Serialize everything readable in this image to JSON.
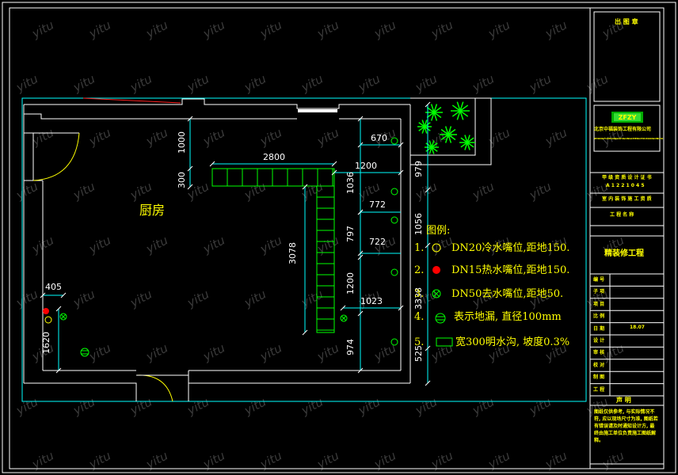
{
  "room_label": "厨房",
  "dimensions": {
    "top_width": "2800",
    "top_height": "1000",
    "counter_depth": "300",
    "counter_len": "3078",
    "d670": "670",
    "d1200a": "1200",
    "d1036": "1036",
    "d772": "772",
    "d797": "797",
    "d722": "722",
    "d1200b": "1200",
    "d1023": "1023",
    "d974": "974",
    "d979": "979",
    "d1056": "1056",
    "d3338": "3338",
    "d525": "525",
    "d405": "405",
    "d1620": "1620"
  },
  "legend": {
    "title": "图例:",
    "items": [
      {
        "num": "1.",
        "text": "DN20冷水嘴位,距地150."
      },
      {
        "num": "2.",
        "text": "DN15热水嘴位,距地150."
      },
      {
        "num": "3.",
        "text": "DN50去水嘴位,距地50."
      },
      {
        "num": "4.",
        "text": "表示地漏, 直径100mm"
      },
      {
        "num": "5.",
        "text": "宽300明水沟, 坡度0.3%"
      }
    ]
  },
  "title_block": {
    "stamp": "出 图 章",
    "company": "北京中福装饰工程有限公司",
    "company_sub": "ZHONGFUZHUANGSHIGONGCHENGYOUXIANGONGSI",
    "cert1": "甲 级 资 质 设 计 证 书",
    "cert2": "A 1 2 2 1 0 4 5",
    "cert3": "室 内 装 饰 施 工 资 质",
    "project_name_label": "工 程 名 称",
    "project_name": "精装修工程",
    "rows": [
      "编 号",
      "子 项",
      "项 目",
      "比 例",
      "日 期",
      "设 计",
      "审 核",
      "校 对",
      "制 图",
      "工 程"
    ],
    "date_val": "18.07",
    "statement_label": "声 明",
    "statement_text": "图纸仅供参考, 与实际情况不符, 应以现场尺寸为准, 图纸若有错误请及时通知设计方, 最终由施工单位负责施工图纸解释。"
  },
  "watermark": "yitu",
  "colors": {
    "background": "#000000",
    "frame": "#ffffff",
    "wall": "#00ffff",
    "counter": "#00ff00",
    "text": "#ffff00",
    "hot": "#ff0000"
  }
}
